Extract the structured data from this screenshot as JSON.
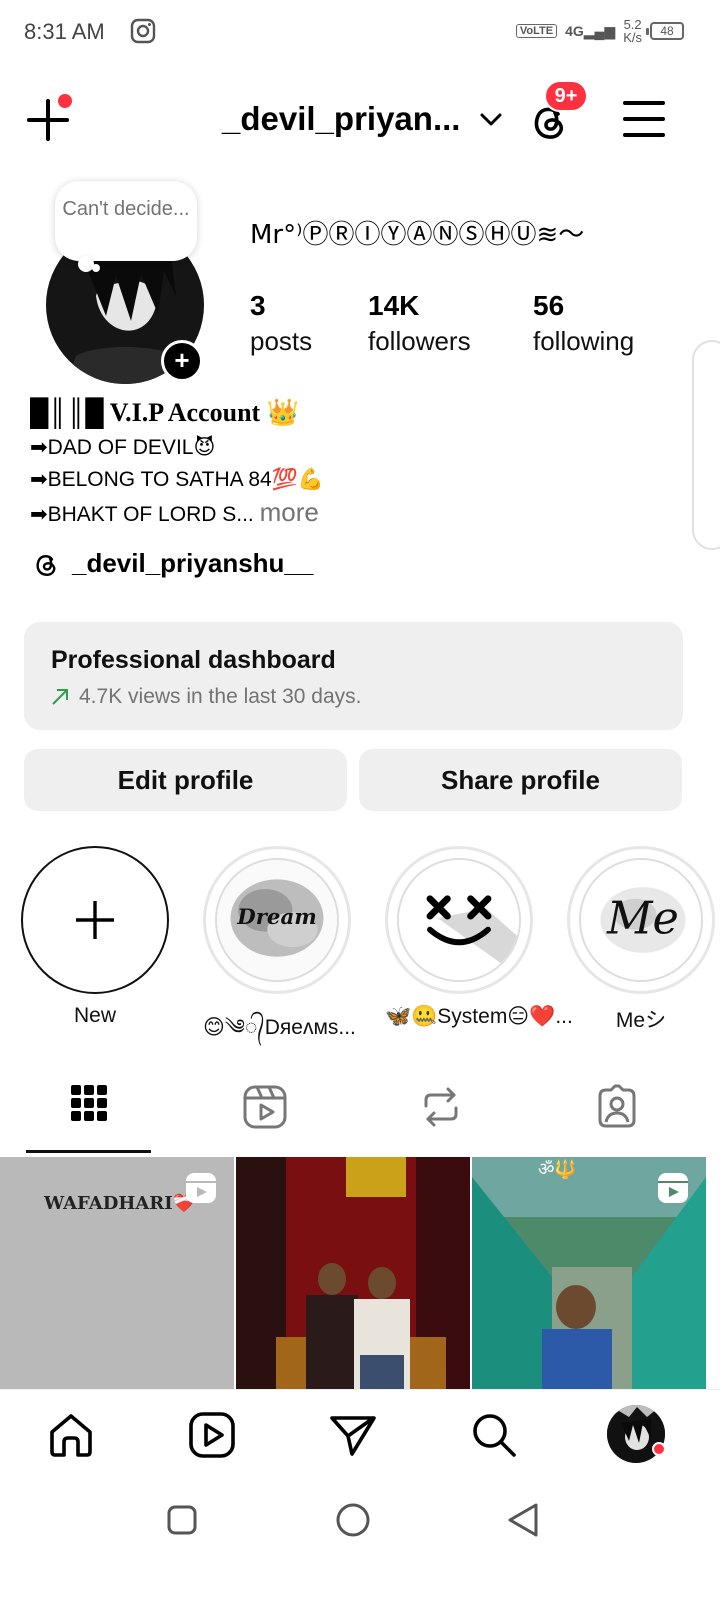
{
  "status_bar": {
    "time": "8:31 AM",
    "network": "VoLTE",
    "signal": "4G",
    "speed_value": "5.2",
    "speed_unit": "K/s",
    "battery": "48"
  },
  "top_bar": {
    "username": "_devil_priyan...",
    "notification_badge": "9+"
  },
  "profile": {
    "note": "Can't decide...",
    "display_name": "Mr°⁾ⓅⓇⒾⓎⒶⓃⓈⒽⓊ≋〜",
    "stats": [
      {
        "value": "3",
        "label": "posts"
      },
      {
        "value": "14K",
        "label": "followers"
      },
      {
        "value": "56",
        "label": "following"
      }
    ],
    "bio": {
      "line1": "█║║█ V.I.P Account 👑",
      "line2": "➡DAD OF DEVIL😈",
      "line3": "➡BELONG TO SATHA 84💯💪",
      "line4": "➡BHAKT OF LORD S...",
      "more": "more"
    },
    "threads_handle": "_devil_priyanshu__"
  },
  "dashboard": {
    "title": "Professional dashboard",
    "subtitle": "4.7K views in the last 30 days."
  },
  "buttons": {
    "edit": "Edit profile",
    "share": "Share profile"
  },
  "highlights": [
    {
      "label": "New"
    },
    {
      "label": "😊༄᭄Dяeʌмs...",
      "cover_text": "Dream"
    },
    {
      "label": "🦋🤐System😑❤️...",
      "cover_text": ""
    },
    {
      "label": "Meシ",
      "cover_text": "Me"
    }
  ],
  "posts": [
    {
      "caption": "WAFADHARI❤️‍🩹",
      "type": "reel"
    },
    {
      "caption": "",
      "type": "photo"
    },
    {
      "caption": "ॐ🔱",
      "type": "reel"
    }
  ],
  "icons": [
    "create-plus-icon",
    "chevron-down-icon",
    "threads-icon",
    "menu-icon",
    "grid-icon",
    "reels-icon",
    "reposts-icon",
    "tagged-icon",
    "home-icon",
    "search-icon",
    "send-icon"
  ],
  "colors": {
    "accent_red": "#ff3040",
    "trend_green": "#2e9e4f",
    "button_bg": "#efefef",
    "muted_text": "#737373"
  }
}
